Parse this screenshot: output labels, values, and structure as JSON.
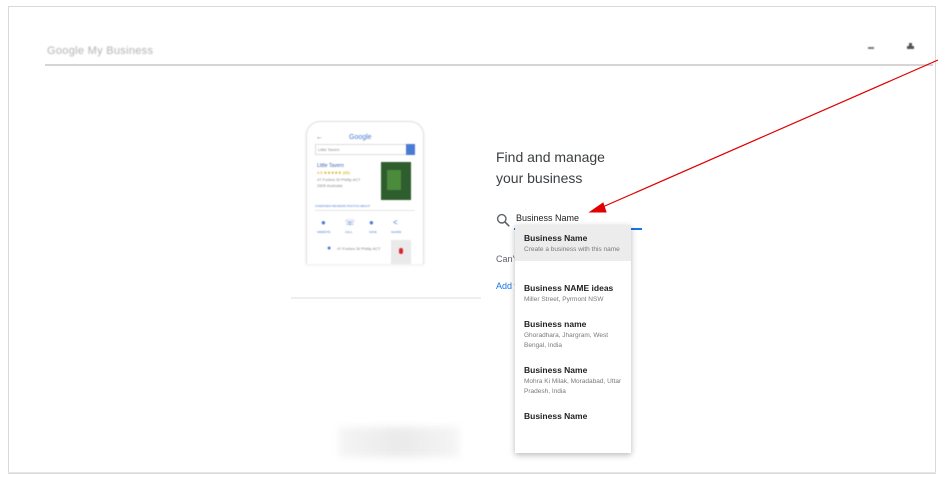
{
  "topbar": {
    "title": "Google My Business",
    "icons": [
      "help-icon",
      "account-icon"
    ]
  },
  "phone_preview": {
    "logo": "Google",
    "search_placeholder": "Little Tavern",
    "business_name": "Little Tavern",
    "rating": "4.5 ★★★★★ (85)",
    "address_line": "47 Forbes St Phillip ACT",
    "hours_line": "2605 Australia",
    "tabs": "OVERVIEW  REVIEWS  PHOTOS  ABOUT",
    "actions": [
      "WEBSITE",
      "CALL",
      "SAVE",
      "SHARE"
    ],
    "location_line": "47 Forbes St Phillip ACT"
  },
  "main": {
    "heading_line1": "Find and manage",
    "heading_line2": "your business",
    "search_value": "Business Name",
    "cant_find_text": "Can't find your business?",
    "add_link_text": "Add your business to Google"
  },
  "suggestions": [
    {
      "title": "Business Name",
      "subtitle": "Create a business with this name"
    },
    {
      "title": "Business NAME ideas",
      "subtitle": "Miller Street, Pyrmont NSW"
    },
    {
      "title": "Business name",
      "subtitle": "Ghoradhara, Jhargram, West Bengal, India"
    },
    {
      "title": "Business Name",
      "subtitle": "Mohra Ki Milak, Moradabad, Uttar Pradesh, India"
    },
    {
      "title": "Business Name",
      "subtitle": ""
    }
  ],
  "colors": {
    "accent_blue": "#1a73e8",
    "annotation_red": "#e00000",
    "text_dark": "#202124"
  }
}
